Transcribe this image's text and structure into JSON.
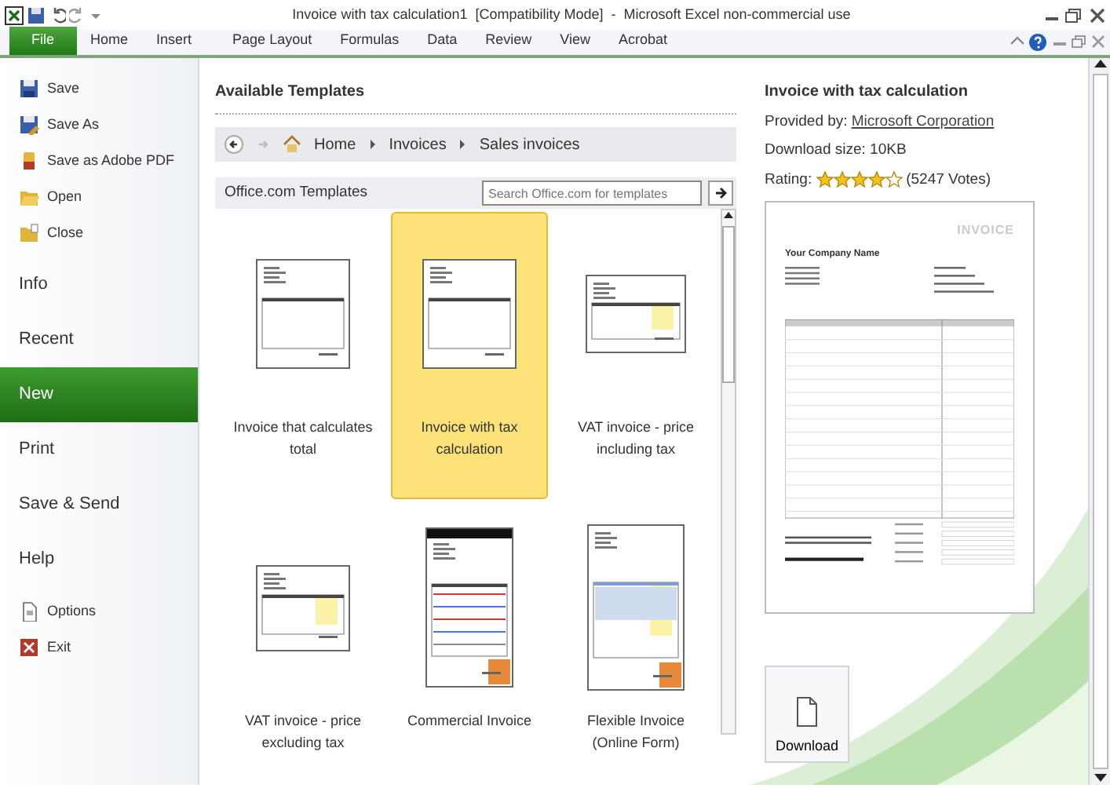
{
  "window": {
    "title": "Invoice with tax calculation1  [Compatibility Mode]  -  Microsoft Excel non-commercial use"
  },
  "ribbon_tabs": [
    {
      "label": "File",
      "selected": true
    },
    {
      "label": "Home",
      "selected": false
    },
    {
      "label": "Insert",
      "selected": false
    },
    {
      "label": "Page Layout",
      "selected": false
    },
    {
      "label": "Formulas",
      "selected": false
    },
    {
      "label": "Data",
      "selected": false
    },
    {
      "label": "Review",
      "selected": false
    },
    {
      "label": "View",
      "selected": false
    },
    {
      "label": "Acrobat",
      "selected": false
    }
  ],
  "sidebar": {
    "items": [
      {
        "label": "Save",
        "kind": "command",
        "selected": false
      },
      {
        "label": "Save As",
        "kind": "command",
        "selected": false
      },
      {
        "label": "Save as Adobe PDF",
        "kind": "command",
        "selected": false
      },
      {
        "label": "Open",
        "kind": "command",
        "selected": false
      },
      {
        "label": "Close",
        "kind": "command",
        "selected": false
      },
      {
        "label": "Info",
        "kind": "tab",
        "selected": false
      },
      {
        "label": "Recent",
        "kind": "tab",
        "selected": false
      },
      {
        "label": "New",
        "kind": "tab",
        "selected": true
      },
      {
        "label": "Print",
        "kind": "tab",
        "selected": false
      },
      {
        "label": "Save & Send",
        "kind": "tab",
        "selected": false
      },
      {
        "label": "Help",
        "kind": "tab",
        "selected": false
      },
      {
        "label": "Options",
        "kind": "command",
        "selected": false
      },
      {
        "label": "Exit",
        "kind": "command",
        "selected": false
      }
    ]
  },
  "templates": {
    "heading": "Available Templates",
    "breadcrumb": [
      "Home",
      "Invoices",
      "Sales invoices"
    ],
    "source": "Office.com Templates",
    "search": {
      "placeholder": "Search Office.com for templates"
    },
    "items": [
      {
        "label": "Invoice that calculates total",
        "selected": false
      },
      {
        "label": "Invoice with tax calculation",
        "selected": true
      },
      {
        "label": "VAT invoice - price including tax",
        "selected": false
      },
      {
        "label": "VAT invoice - price excluding tax",
        "selected": false
      },
      {
        "label": "Commercial Invoice",
        "selected": false
      },
      {
        "label": "Flexible Invoice (Online Form)",
        "selected": false
      }
    ]
  },
  "details": {
    "title": "Invoice with tax calculation",
    "provided_by_label": "Provided by:",
    "provided_by": "Microsoft Corporation",
    "download_size": "Download size: 10KB",
    "rating_label": "Rating:",
    "stars": 4,
    "votes": "(5247 Votes)",
    "preview": {
      "heading": "INVOICE",
      "company": "Your Company Name"
    },
    "download_button": "Download"
  }
}
